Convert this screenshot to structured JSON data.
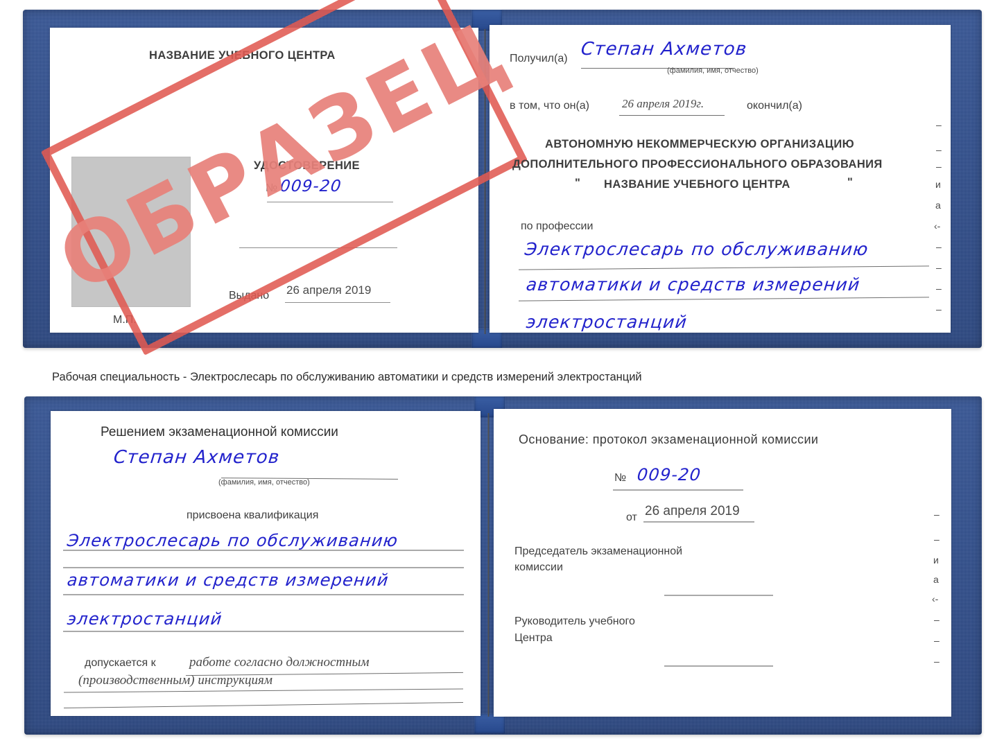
{
  "document": {
    "type": "certificate-scan",
    "title": "Удостоверение о рабочей специальности",
    "stamp_text": "ОБРАЗЕЦ",
    "colors": {
      "cover": "#27488c",
      "stamp": "#e05a52",
      "handwriting": "#2222cc",
      "photo_placeholder": "#c6c6c6"
    }
  },
  "caption": {
    "text": "Рабочая специальность - Электрослесарь по обслуживанию автоматики и средств измерений электростанций"
  },
  "certificate_top": {
    "left_page": {
      "center_name": "НАЗВАНИЕ УЧЕБНОГО ЦЕНТРА",
      "doc_title": "УДОСТОВЕРЕНИЕ",
      "number_label": "№",
      "number_value": "009-20",
      "issued_label": "Выдано",
      "issued_value": "26 апреля 2019",
      "seal_label": "М.П."
    },
    "right_page": {
      "received_label": "Получил(а)",
      "received_value": "Степан Ахметов",
      "fio_hint": "(фамилия, имя, отчество)",
      "that_he_label": "в том, что он(а)",
      "that_he_value": "26 апреля 2019г.",
      "finished_label": "окончил(а)",
      "org_line1": "АВТОНОМНУЮ НЕКОММЕРЧЕСКУЮ ОРГАНИЗАЦИЮ",
      "org_line2": "ДОПОЛНИТЕЛЬНОГО ПРОФЕССИОНАЛЬНОГО ОБРАЗОВАНИЯ",
      "org_quote_open": "\"",
      "org_line3": "НАЗВАНИЕ УЧЕБНОГО ЦЕНТРА",
      "org_quote_close": "\"",
      "profession_label": "по профессии",
      "profession_line1": "Электрослесарь по обслуживанию",
      "profession_line2": "автоматики и средств измерений",
      "profession_line3": "электростанций"
    },
    "edge_fragments": [
      "–",
      "–",
      "–",
      "и",
      "а",
      "‹-",
      "–",
      "–",
      "–",
      "–"
    ]
  },
  "certificate_bottom": {
    "left_page": {
      "decision_title": "Решением экзаменационной комиссии",
      "name_value": "Степан Ахметов",
      "fio_hint": "(фамилия, имя, отчество)",
      "qualification_label": "присвоена квалификация",
      "qualification_line1": "Электрослесарь по обслуживанию",
      "qualification_line2": "автоматики и средств измерений",
      "qualification_line3": "электростанций",
      "allowed_label": "допускается к",
      "allowed_value_line1": "работе согласно должностным",
      "allowed_value_line2": "(производственным) инструкциям"
    },
    "right_page": {
      "basis_label": "Основание: протокол экзаменационной комиссии",
      "number_label": "№",
      "number_value": "009-20",
      "date_label": "от",
      "date_value": "26 апреля 2019",
      "chairman_line1": "Председатель экзаменационной",
      "chairman_line2": "комиссии",
      "head_line1": "Руководитель учебного",
      "head_line2": "Центра"
    },
    "edge_fragments": [
      "–",
      "–",
      "и",
      "а",
      "‹-",
      "–",
      "–",
      "–"
    ]
  }
}
